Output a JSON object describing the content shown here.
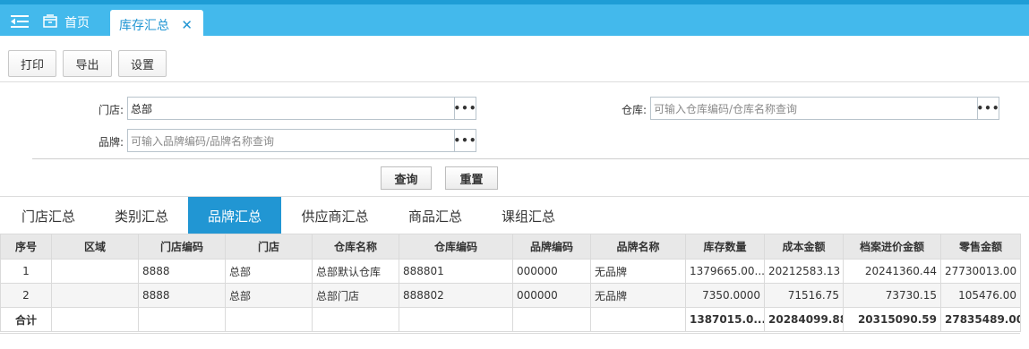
{
  "topnav": {
    "home_label": "首页",
    "active_tab_label": "库存汇总"
  },
  "toolbar": {
    "print_label": "打印",
    "export_label": "导出",
    "settings_label": "设置"
  },
  "filters": {
    "store_label": "门店:",
    "store_value": "总部",
    "warehouse_label": "仓库:",
    "warehouse_placeholder": "可输入仓库编码/仓库名称查询",
    "brand_label": "品牌:",
    "brand_placeholder": "可输入品牌编码/品牌名称查询",
    "ellipsis": "•••"
  },
  "actions": {
    "query_label": "查询",
    "reset_label": "重置"
  },
  "tabs": [
    "门店汇总",
    "类别汇总",
    "品牌汇总",
    "供应商汇总",
    "商品汇总",
    "课组汇总"
  ],
  "active_tab_index": 2,
  "grid": {
    "headers": [
      "序号",
      "区域",
      "门店编码",
      "门店",
      "仓库名称",
      "仓库编码",
      "品牌编码",
      "品牌名称",
      "库存数量",
      "成本金额",
      "档案进价金额",
      "零售金额"
    ],
    "rows": [
      [
        "1",
        "",
        "8888",
        "总部",
        "总部默认仓库",
        "888801",
        "000000",
        "无品牌",
        "1379665.00...",
        "20212583.13",
        "20241360.44",
        "27730013.00"
      ],
      [
        "2",
        "",
        "8888",
        "总部",
        "总部门店",
        "888802",
        "000000",
        "无品牌",
        "7350.0000",
        "71516.75",
        "73730.15",
        "105476.00"
      ]
    ],
    "total": [
      "合计",
      "",
      "",
      "",
      "",
      "",
      "",
      "",
      "1387015.0...",
      "20284099.88",
      "20315090.59",
      "27835489.00"
    ]
  },
  "colors": {
    "topbar": "#43b9ec",
    "accent": "#2196d3"
  }
}
